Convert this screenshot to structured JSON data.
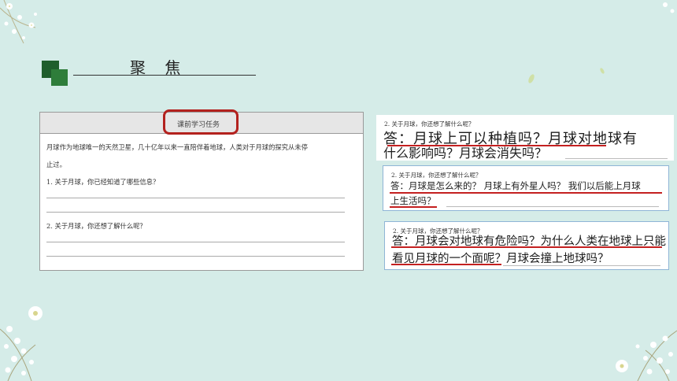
{
  "slide": {
    "title": "聚 焦",
    "accent_color": "#b3211e",
    "square_colors": [
      "#1f5e2c",
      "#2e7d3a"
    ]
  },
  "worksheet": {
    "header_label": "课前学习任务",
    "intro_line1": "月球作为地球唯一的天然卫星，几十亿年以来一直陪伴着地球，人类对于月球的探究从未停",
    "intro_line2": "止过。",
    "question1": "1.  关于月球，你已经知道了哪些信息？",
    "question2": "2.  关于月球，你还想了解什么呢？"
  },
  "answers": [
    {
      "question": "2.  关于月球，你还想了解什么呢？",
      "line1": "答：月球上可以种植吗？月球对地球有",
      "line2": "什么影响吗？月球会消失吗？"
    },
    {
      "question": "2.  关于月球，你还想了解什么呢？",
      "line1": "答：月球是怎么来的？ 月球上有外星人吗？ 我们以后能上月球",
      "line2": "上生活吗？"
    },
    {
      "question": "2.  关于月球，你还想了解什么呢？",
      "line1": "答：月球会对地球有危险吗？为什么人类在地球上只能",
      "line2": "看见月球的一个面呢？月球会撞上地球吗？"
    }
  ]
}
